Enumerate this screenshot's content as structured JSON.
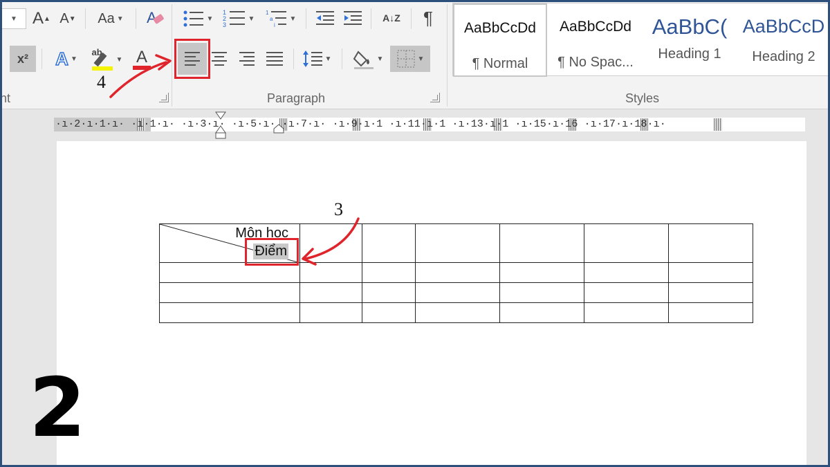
{
  "ribbon": {
    "font_group": {
      "label": "nt",
      "grow_font": "A",
      "shrink_font": "A",
      "change_case": "Aa",
      "superscript": "x²",
      "text_effects": "A",
      "highlight": "ab",
      "font_color": "A"
    },
    "paragraph_group": {
      "label": "Paragraph",
      "pilcrow": "¶",
      "sort": "A↓Z"
    },
    "styles_group": {
      "label": "Styles",
      "items": [
        {
          "sample": "AaBbCcDd",
          "name": "¶ Normal"
        },
        {
          "sample": "AaBbCcDd",
          "name": "¶ No Spac..."
        },
        {
          "sample": "AaBbC(",
          "name": "Heading 1"
        },
        {
          "sample": "AaBbCcD",
          "name": "Heading 2"
        }
      ]
    }
  },
  "ruler": {
    "text": "·ı·2·ı·1·ı·  ·ı·1·ı·  ·ı·3·ı·  ·ı·5·ı·  ·ı·7·ı·  ·ı·9·ı·1 ·ı·11·ı·1 ·ı·13·ı·1 ·ı·15·ı·16 ·ı·17·ı·18·ı·"
  },
  "document": {
    "header_cell": {
      "top_label": "Môn học",
      "bottom_label": "Điểm"
    }
  },
  "annotations": {
    "step_3": "3",
    "step_4": "4",
    "step_big": "2"
  },
  "colors": {
    "annotation": "#e0242b",
    "heading": "#2f5597",
    "frame": "#2d4f7c"
  }
}
